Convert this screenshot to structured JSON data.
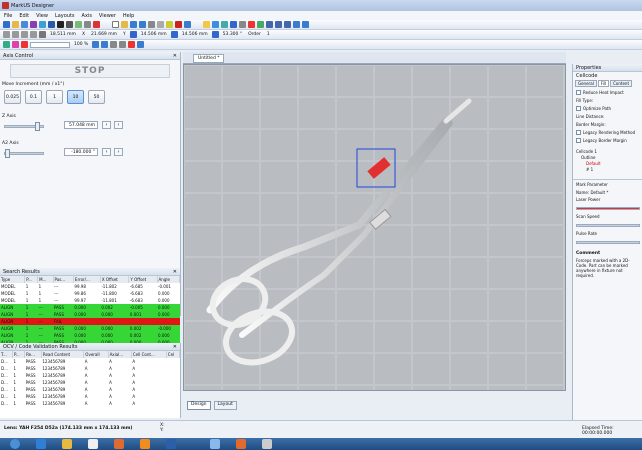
{
  "window": {
    "title": "MarkUS Designer"
  },
  "menu": [
    "File",
    "Edit",
    "View",
    "Layouts",
    "Axis",
    "Viewer",
    "Help"
  ],
  "toolbar": {
    "x_value": "18.511 mm",
    "x_label": "X",
    "y_value": "21.669 mm",
    "y_label": "Y",
    "w_value": "14.506 mm",
    "h_value": "14.506 mm",
    "rot_value": "53.300 °",
    "order_label": "Order",
    "order_value": "1",
    "zoom": "100 %"
  },
  "axis_panel": {
    "title": "Axis Control",
    "stop_label": "STOP",
    "move_increment_label": "Move Increment (mm / x1°)",
    "increments": [
      "0.025",
      "0.1",
      "1",
      "10",
      "50"
    ],
    "selected_increment": "10",
    "z_label": "Z Axis",
    "z_value": "57.048 mm",
    "a2_label": "A2 Axis",
    "a2_value": "-180.000 °"
  },
  "search_results": {
    "title": "Search Results",
    "columns": [
      "Type",
      "P...",
      "M...",
      "Pas...",
      "Error/...",
      "X Offset",
      "Y Offset",
      "Angle"
    ],
    "rows": [
      {
        "cells": [
          "MODEL",
          "1",
          "1",
          "---",
          "99.98",
          "-11.802",
          "-6.685",
          "-0.001"
        ],
        "status": "model"
      },
      {
        "cells": [
          "MODEL",
          "1",
          "1",
          "---",
          "99.86",
          "-11.800",
          "-6.683",
          "0.000"
        ],
        "status": "model"
      },
      {
        "cells": [
          "MODEL",
          "1",
          "1",
          "---",
          "99.97",
          "-11.801",
          "-6.683",
          "0.000"
        ],
        "status": "model"
      },
      {
        "cells": [
          "ALIGN",
          "1",
          "---",
          "PASS",
          "0.000",
          "0.002",
          "-0.005",
          "0.000"
        ],
        "status": "pass"
      },
      {
        "cells": [
          "ALIGN",
          "1",
          "---",
          "PASS",
          "0.000",
          "0.000",
          "0.001",
          "0.000"
        ],
        "status": "pass"
      },
      {
        "cells": [
          "ALIGN",
          "1",
          "---",
          "FAIL",
          "",
          "",
          "",
          ""
        ],
        "status": "fail"
      },
      {
        "cells": [
          "ALIGN",
          "1",
          "---",
          "PASS",
          "0.000",
          "0.000",
          "0.002",
          "-0.000"
        ],
        "status": "pass"
      },
      {
        "cells": [
          "ALIGN",
          "1",
          "---",
          "PASS",
          "0.000",
          "0.000",
          "0.002",
          "0.000"
        ],
        "status": "pass"
      },
      {
        "cells": [
          "ALIGN",
          "1",
          "---",
          "PASS",
          "0.000",
          "0.000",
          "0.000",
          "0.000"
        ],
        "status": "pass"
      }
    ]
  },
  "ocv": {
    "title": "OCV / Code Validation Results",
    "columns": [
      "T...",
      "P...",
      "Re...",
      "Read Content",
      "Overall",
      "Axial...",
      "Cell Cont...",
      "Cel"
    ],
    "rows": [
      [
        "D...",
        "1",
        "PASS",
        "123456789",
        "A",
        "A",
        "A"
      ],
      [
        "D...",
        "1",
        "PASS",
        "123456789",
        "A",
        "A",
        "A"
      ],
      [
        "D...",
        "1",
        "PASS",
        "123456789",
        "A",
        "A",
        "A"
      ],
      [
        "D...",
        "1",
        "PASS",
        "123456789",
        "A",
        "A",
        "A"
      ],
      [
        "D...",
        "1",
        "PASS",
        "123456789",
        "A",
        "A",
        "A"
      ],
      [
        "D...",
        "1",
        "PASS",
        "123456789",
        "A",
        "A",
        "A"
      ],
      [
        "D...",
        "1",
        "PASS",
        "123456789",
        "A",
        "A",
        "A"
      ]
    ]
  },
  "canvas": {
    "tab": "Untitled *",
    "design_tab": "Design",
    "layout_tab": "Layout",
    "ruler_top": [
      "8",
      "16",
      "24",
      "32",
      "40",
      "48",
      "56",
      "64",
      "72",
      "80",
      "88",
      "96",
      "104",
      "112",
      "120",
      "128",
      "136",
      "144",
      "152",
      "160",
      "168"
    ]
  },
  "props": {
    "title": "Properties",
    "section": "Cellcode",
    "tabs": [
      "General",
      "Fill",
      "Content"
    ],
    "reduce_heat": "Reduce Heat Impact",
    "fill_type": "Fill Type:",
    "optimize_path": "Optimize Path",
    "line_distance": "Line Distance:",
    "border_margin": "Border Margin:",
    "legacy_rendering": "Legacy Rendering Method",
    "legacy_border": "Legacy Border Margin",
    "tree_root": "Cellcode 1",
    "tree_outline": "Outline",
    "tree_default": "Default",
    "tree_hash": "# 1",
    "mark_param": "Mark Parameter",
    "name_label": "Name:",
    "name_value": "Default *",
    "laser_power": "Laser Power",
    "scan_speed": "Scan Speed",
    "pulse_rate": "Pulse Rate",
    "comment_label": "Comment",
    "comment_text": "Forceps marked with a 2D-Code. Part can be marked anywhere in fixture not required.",
    "elapsed": "Elapsed Time: 00:00:00.000"
  },
  "status": {
    "lens": "Lens: YAH F254 D52a  (174.133 mm x 174.133 mm)",
    "coords": "X:\nY:"
  },
  "colors": {
    "pass": "#37d637",
    "fail": "#e01515",
    "accent": "#3a6ea5"
  }
}
